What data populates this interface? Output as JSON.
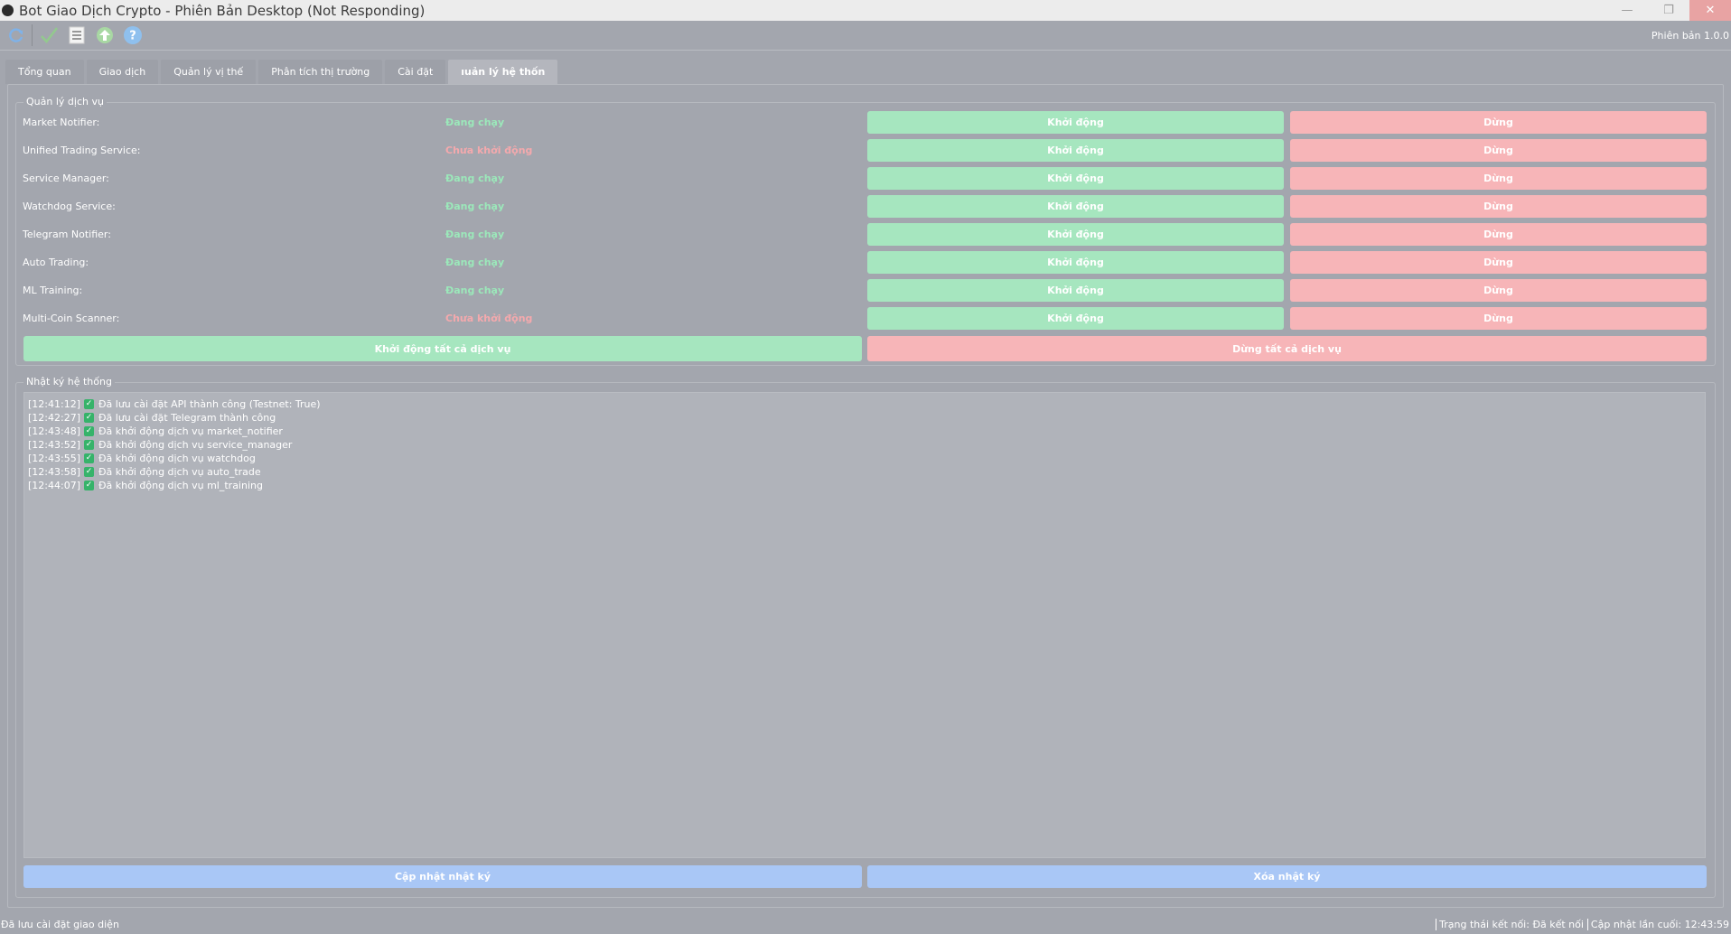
{
  "window": {
    "title": "Bot Giao Dịch Crypto - Phiên Bản Desktop (Not Responding)",
    "minimize_label": "—",
    "maximize_label": "❐",
    "close_label": "✕"
  },
  "toolbar": {
    "version": "Phiên bản 1.0.0",
    "icons": [
      "refresh-icon",
      "check-icon",
      "list-icon",
      "upload-arrow-icon",
      "help-icon"
    ]
  },
  "tabs": [
    {
      "label": "Tổng quan"
    },
    {
      "label": "Giao dịch"
    },
    {
      "label": "Quản lý vị thế"
    },
    {
      "label": "Phân tích thị trường"
    },
    {
      "label": "Cài đặt"
    },
    {
      "label": "ıuản lý hệ thốn"
    }
  ],
  "services": {
    "group_title": "Quản lý dịch vụ",
    "start_label": "Khởi động",
    "stop_label": "Dừng",
    "items": [
      {
        "name": "Market Notifier:",
        "status": "Đang chạy",
        "state": "running"
      },
      {
        "name": "Unified Trading Service:",
        "status": "Chưa khởi động",
        "state": "stopped"
      },
      {
        "name": "Service Manager:",
        "status": "Đang chạy",
        "state": "running"
      },
      {
        "name": "Watchdog Service:",
        "status": "Đang chạy",
        "state": "running"
      },
      {
        "name": "Telegram Notifier:",
        "status": "Đang chạy",
        "state": "running"
      },
      {
        "name": "Auto Trading:",
        "status": "Đang chạy",
        "state": "running"
      },
      {
        "name": "ML Training:",
        "status": "Đang chạy",
        "state": "running"
      },
      {
        "name": "Multi-Coin Scanner:",
        "status": "Chưa khởi động",
        "state": "stopped"
      }
    ],
    "start_all_label": "Khởi động tất cả dịch vụ",
    "stop_all_label": "Dừng tất cả dịch vụ"
  },
  "log": {
    "group_title": "Nhật ký hệ thống",
    "entries": [
      {
        "time": "[12:41:12]",
        "text": "Đã lưu cài đặt API thành công (Testnet: True)"
      },
      {
        "time": "[12:42:27]",
        "text": "Đã lưu cài đặt Telegram thành công"
      },
      {
        "time": "[12:43:48]",
        "text": "Đã khởi động dịch vụ market_notifier"
      },
      {
        "time": "[12:43:52]",
        "text": "Đã khởi động dịch vụ service_manager"
      },
      {
        "time": "[12:43:55]",
        "text": "Đã khởi động dịch vụ watchdog"
      },
      {
        "time": "[12:43:58]",
        "text": "Đã khởi động dịch vụ auto_trade"
      },
      {
        "time": "[12:44:07]",
        "text": "Đã khởi động dịch vụ ml_training"
      }
    ],
    "refresh_label": "Cập nhật nhật ký",
    "clear_label": "Xóa nhật ký"
  },
  "statusbar": {
    "message": "Đã lưu cài đặt giao diện",
    "connection": "Trạng thái kết nối: Đã kết nối",
    "last_update": "Cập nhật lần cuối: 12:43:59"
  },
  "colors": {
    "background": "#a3a6ae",
    "start_button": "#a6e6bf",
    "stop_button": "#f7b5b8",
    "action_button": "#a9c7f6",
    "status_running": "#9be8ba",
    "status_stopped": "#f4a9ad"
  }
}
